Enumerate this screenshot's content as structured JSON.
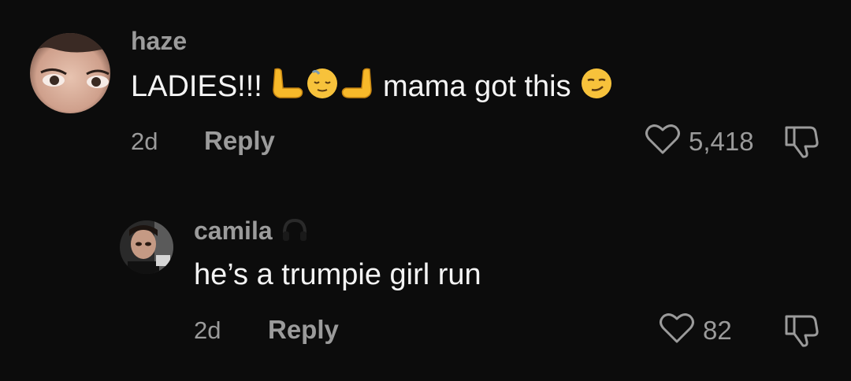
{
  "comments": [
    {
      "username": "haze",
      "text_before": "LADIES!!!",
      "emojis": [
        "backhand-point-left-emoji",
        "relieved-face-emoji",
        "backhand-point-right-emoji"
      ],
      "text_after": "mama got this",
      "trailing_emoji": "smirking-face-emoji",
      "time": "2d",
      "reply_label": "Reply",
      "likes": "5,418",
      "avatar": "woman-face-avatar"
    },
    {
      "username": "camila",
      "badge": "headphones-icon",
      "text": "he’s a trumpie girl run",
      "time": "2d",
      "reply_label": "Reply",
      "likes": "82",
      "avatar": "person-selfie-avatar"
    }
  ],
  "colors": {
    "background": "#0c0c0c",
    "secondary_text": "#9b9b9b",
    "primary_text": "#f4f4f4",
    "emoji_yellow": "#f7b92a"
  }
}
